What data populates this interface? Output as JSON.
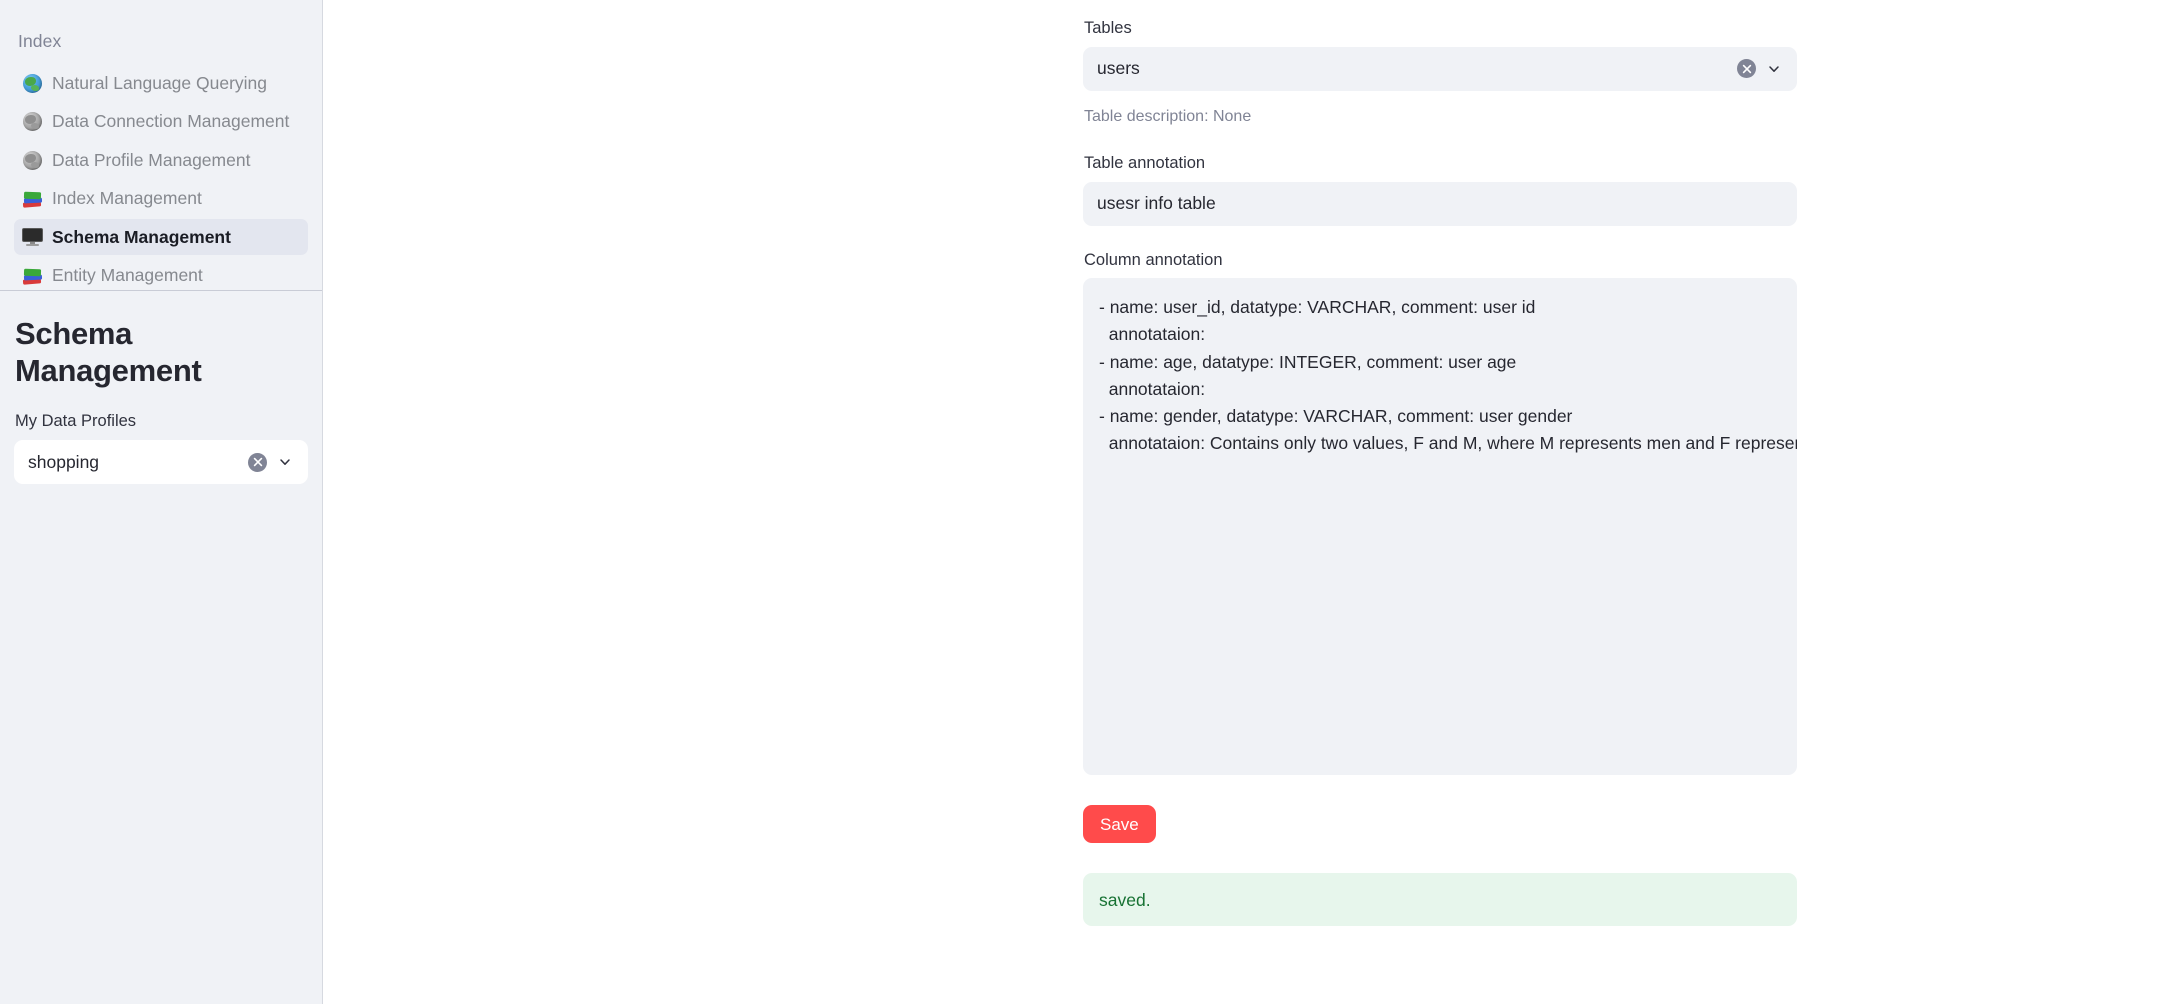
{
  "sidebar": {
    "nav_header": "Index",
    "items": [
      {
        "label": "Natural Language Querying",
        "icon": "globe-icon",
        "active": false
      },
      {
        "label": "Data Connection Management",
        "icon": "globe-grey-icon",
        "active": false
      },
      {
        "label": "Data Profile Management",
        "icon": "globe-grey-icon",
        "active": false
      },
      {
        "label": "Index Management",
        "icon": "books-icon",
        "active": false
      },
      {
        "label": "Schema Management",
        "icon": "monitor-icon",
        "active": true
      },
      {
        "label": "Entity Management",
        "icon": "books-icon",
        "active": false
      }
    ],
    "page_title": "Schema Management",
    "profile_label": "My Data Profiles",
    "profile_value": "shopping",
    "profile_placeholder": "Choose an option"
  },
  "main": {
    "tables_label": "Tables",
    "tables_value": "users",
    "tables_placeholder": "Choose an option",
    "table_description": "Table description: None",
    "table_annotation_label": "Table annotation",
    "table_annotation_value": "usesr info table",
    "table_annotation_placeholder": "",
    "column_annotation_label": "Column annotation",
    "column_annotation_value": "- name: user_id, datatype: VARCHAR, comment: user id\n  annotataion:\n- name: age, datatype: INTEGER, comment: user age\n  annotataion:\n- name: gender, datatype: VARCHAR, comment: user gender\n  annotataion: Contains only two values, F and M, where M represents men and F represents women",
    "column_annotation_placeholder": "",
    "save_label": "Save",
    "status_message": "saved."
  },
  "colors": {
    "accent_red": "#ff4b4b",
    "sidebar_bg": "#f0f2f6",
    "input_bg": "#f0f2f6",
    "success_bg": "#e7f6ec",
    "success_text": "#177233",
    "muted_text": "#808495",
    "body_text": "#262730"
  }
}
